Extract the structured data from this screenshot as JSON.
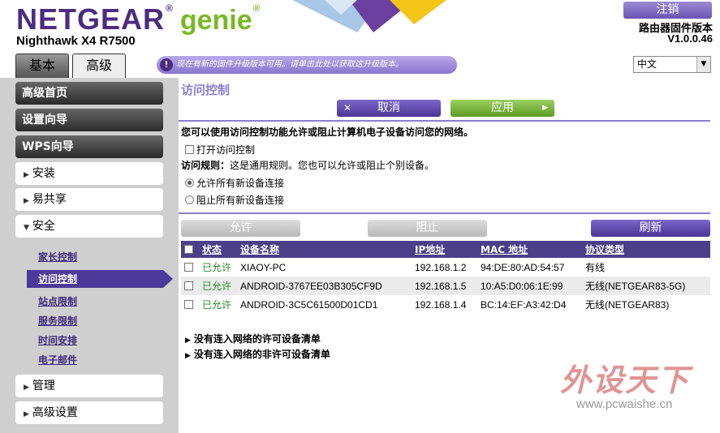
{
  "header": {
    "brand": "NETGEAR",
    "brand_mark": "®",
    "product": "genie",
    "product_mark": "®",
    "model": "Nighthawk X4 R7500",
    "logout_label": "注销",
    "firmware_label": "路由器固件版本",
    "firmware_version": "V1.0.0.46",
    "tabs": {
      "basic": "基本",
      "advanced": "高级"
    },
    "notice": "现在有新的固件升级版本可用。请单击此处以获取这升级版本。",
    "language": "中文"
  },
  "sidebar": {
    "advanced_home": "高级首页",
    "setup_wizard": "设置向导",
    "wps_wizard": "WPS向导",
    "setup": "安装",
    "readyshare": "易共享",
    "security": "安全",
    "security_items": [
      "家长控制",
      "访问控制",
      "站点限制",
      "服务限制",
      "时间安排",
      "电子邮件"
    ],
    "management": "管理",
    "advanced_setup": "高级设置"
  },
  "main": {
    "title": "访问控制",
    "cancel_label": "取消",
    "apply_label": "应用",
    "description": "您可以使用访问控制功能允许或阻止计算机电子设备访问您的网络。",
    "enable_label": "打开访问控制",
    "rule_prefix": "访问规则：",
    "rule_text": "这是通用规则。您也可以允许或阻止个别设备。",
    "radio_allow": "允许所有新设备连接",
    "radio_block": "阻止所有新设备连接",
    "allow_btn": "允许",
    "block_btn": "阻止",
    "refresh_btn": "刷新",
    "columns": [
      "状态",
      "设备名称",
      "IP地址",
      "MAC 地址",
      "协议类型"
    ],
    "rows": [
      {
        "status": "已允许",
        "name": "XIAOY-PC",
        "ip": "192.168.1.2",
        "mac": "94:DE:80:AD:54:57",
        "type": "有线"
      },
      {
        "status": "已允许",
        "name": "ANDROID-3767EE03B305CF9D",
        "ip": "192.168.1.5",
        "mac": "10:A5:D0:06:1E:99",
        "type": "无线(NETGEAR83-5G)"
      },
      {
        "status": "已允许",
        "name": "ANDROID-3C5C61500D01CD1",
        "ip": "192.168.1.4",
        "mac": "BC:14:EF:A3:42:D4",
        "type": "无线(NETGEAR83)"
      }
    ],
    "allowed_not_connected": "没有连入网络的许可设备清单",
    "blocked_not_connected": "没有连入网络的非许可设备清单"
  },
  "watermark": {
    "text": "外设天下",
    "url": "www.pcwaishe.cn"
  },
  "colors": {
    "brand_purple": "#4b2c82",
    "genie_green": "#7ab824",
    "allowed_green": "#2e8b2e"
  }
}
